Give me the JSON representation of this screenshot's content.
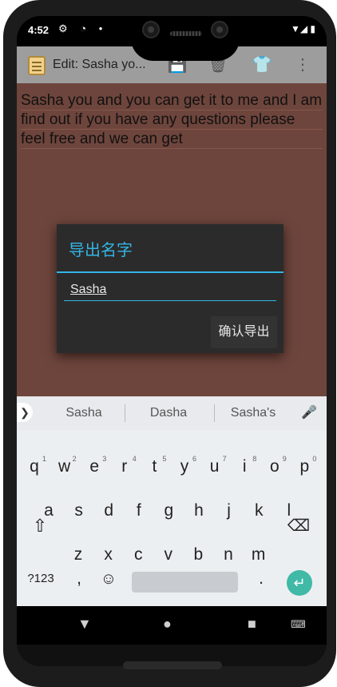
{
  "status_bar": {
    "time": "4:52",
    "left_icons": "⚙ ◔ •",
    "right_icons": "▼◢ ▮"
  },
  "app_bar": {
    "title": "Edit: Sasha yo...",
    "actions": [
      "save-icon",
      "delete-icon",
      "shirt-icon",
      "more-icon"
    ]
  },
  "editor": {
    "text": "Sasha you and you can get it to me and I am find out if you have any questions please feel free and we can get"
  },
  "dialog": {
    "title": "导出名字",
    "input_value": "Sasha",
    "confirm_label": "确认导出"
  },
  "keyboard": {
    "suggestions": [
      "Sasha",
      "Dasha",
      "Sasha's"
    ],
    "row1": [
      {
        "k": "q",
        "n": "1"
      },
      {
        "k": "w",
        "n": "2"
      },
      {
        "k": "e",
        "n": "3"
      },
      {
        "k": "r",
        "n": "4"
      },
      {
        "k": "t",
        "n": "5"
      },
      {
        "k": "y",
        "n": "6"
      },
      {
        "k": "u",
        "n": "7"
      },
      {
        "k": "i",
        "n": "8"
      },
      {
        "k": "o",
        "n": "9"
      },
      {
        "k": "p",
        "n": "0"
      }
    ],
    "row2": [
      "a",
      "s",
      "d",
      "f",
      "g",
      "h",
      "j",
      "k",
      "l"
    ],
    "row3": [
      "z",
      "x",
      "c",
      "v",
      "b",
      "n",
      "m"
    ],
    "symbols_label": "?123",
    "comma": ",",
    "period": "."
  },
  "colors": {
    "accent": "#33b5e5",
    "editor_bg": "#6e453c",
    "enter_key": "#40b9a7"
  }
}
